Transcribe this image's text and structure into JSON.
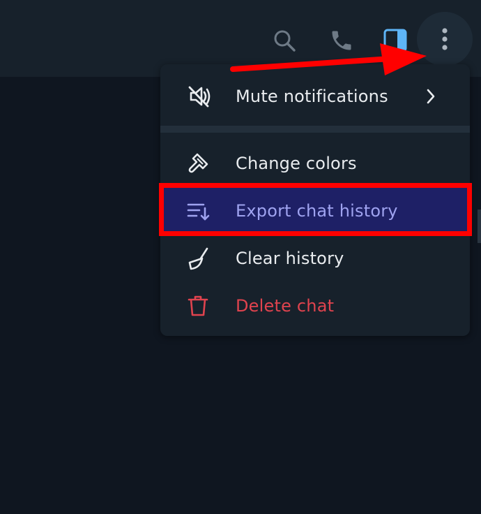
{
  "header": {
    "icons": [
      "search-icon",
      "phone-icon",
      "sidebar-toggle-icon",
      "more-vertical-icon"
    ]
  },
  "menu": {
    "items": [
      {
        "label": "Mute notifications",
        "icon": "mute-bell-icon",
        "has_submenu": true
      },
      {
        "label": "Change colors",
        "icon": "paint-brush-icon"
      },
      {
        "label": "Export chat history",
        "icon": "export-list-icon",
        "selected": true
      },
      {
        "label": "Clear history",
        "icon": "broom-icon"
      },
      {
        "label": "Delete chat",
        "icon": "trash-icon",
        "danger": true
      }
    ]
  },
  "colors": {
    "background": "#0f1620",
    "header": "#17212b",
    "menu": "#17212b",
    "selected": "#1e2066",
    "danger": "#e0434e",
    "annotation": "#ff0000"
  }
}
